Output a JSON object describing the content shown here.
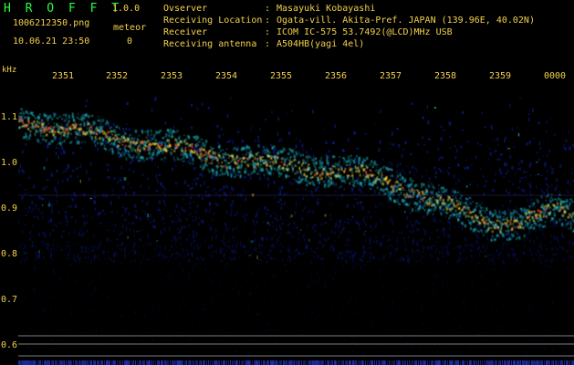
{
  "app": {
    "title": "H R O F F T",
    "version": "1.0.0",
    "file_name": "1006212350.png",
    "meteor_label": "meteor",
    "datetime": "10.06.21 23:50",
    "meteor_count": "0"
  },
  "observation_info": [
    {
      "label": "Ovserver",
      "separator": ":",
      "value": "Masayuki Kobayashi"
    },
    {
      "label": "Receiving Location",
      "separator": ":",
      "value": "Ogata-vill. Akita-Pref. JAPAN (139.96E, 40.02N)"
    },
    {
      "label": "Receiver",
      "separator": ":",
      "value": "ICOM IC-575 53.7492(@LCD)MHz USB"
    },
    {
      "label": "Receiving antenna",
      "separator": ":",
      "value": "A504HB(yagi 4el)"
    }
  ],
  "axis": {
    "unit_label": "kHz",
    "x_ticks": [
      "2351",
      "2352",
      "2353",
      "2354",
      "2355",
      "2356",
      "2357",
      "2358",
      "2359",
      "0000"
    ],
    "y_ticks": [
      "1.1",
      "1.0",
      "0.9",
      "0.8",
      "0.7",
      "0.6"
    ]
  },
  "colors": {
    "label": "#f2d14a",
    "title": "#26ff42",
    "background": "#000000",
    "guide_lines": "#c7c7c7",
    "signal_low": "#0d21b3",
    "signal_mid": "#1fd3e6",
    "signal_high": "#ffe51f",
    "signal_peak": "#ff3b1f"
  }
}
